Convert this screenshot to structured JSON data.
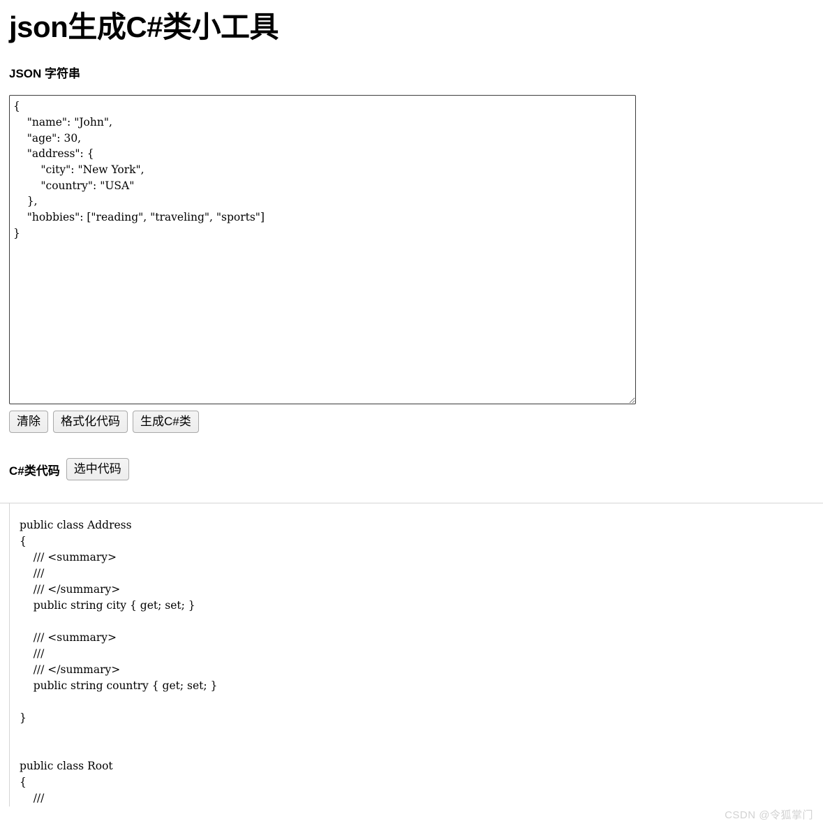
{
  "page": {
    "title": "json生成C#类小工具"
  },
  "json_section": {
    "label": "JSON 字符串",
    "textarea_value": "{\n    \"name\": \"John\",\n    \"age\": 30,\n    \"address\": {\n        \"city\": \"New York\",\n        \"country\": \"USA\"\n    },\n    \"hobbies\": [\"reading\", \"traveling\", \"sports\"]\n}",
    "textarea_placeholder": ""
  },
  "toolbar": {
    "clear_label": "清除",
    "format_label": "格式化代码",
    "generate_label": "生成C#类"
  },
  "csharp_section": {
    "label": "C#类代码",
    "select_code_label": "选中代码",
    "code": "public class Address\n{\n    /// <summary>\n    /// \n    /// </summary>\n    public string city { get; set; }\n\n    /// <summary>\n    /// \n    /// </summary>\n    public string country { get; set; }\n\n}\n\n\npublic class Root\n{\n    ///"
  },
  "watermark": {
    "text": "CSDN @令狐掌门"
  },
  "colors": {
    "background": "#ffffff",
    "text": "#000000",
    "textarea_border": "#3c3c3c",
    "code_border": "#d5d5d5",
    "button_face": "#efefef",
    "button_border": "#a9a9a9",
    "watermark": "#d2d2d2"
  }
}
